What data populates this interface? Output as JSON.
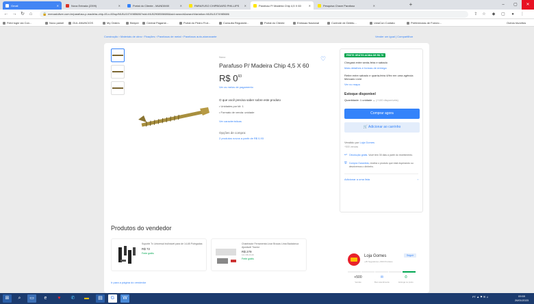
{
  "browser": {
    "tabs": [
      {
        "label": "Gmail"
      },
      {
        "label": "Nova Entrada (2399)"
      },
      {
        "label": "Portal do Cliente - MUNDIMIX"
      },
      {
        "label": "PARAFUSO CHIPBOARD PHILLIPS"
      },
      {
        "label": "Parafuso P/ Madeira Chip 4,5 X 60"
      },
      {
        "label": "Pesquisa Chave Parafuso"
      }
    ],
    "url": "mercadolivre.com.br/parafuso-p-madeira-chip-45-x-60/up/MLBU1074985686?wid=MLB2908506686&sid=search&searchVariation=MLBU1074985686",
    "bookmarks": [
      "Field login via Con...",
      "Novo painel",
      "GUL ANUNCIOS",
      "My Orders",
      "Beeper",
      "Central Pagame...",
      "Portal do Pedro Frut...",
      "Consulta Regularid...",
      "Portal do Cliente",
      "Emissao Nacional",
      "Controle de Debito...",
      "UniaCon Contato",
      "Preferencias de Fornec...",
      "Outros favoritos"
    ]
  },
  "page": {
    "breadcrumb": "Construção › Materiais de obra › Fixações › Parafusos de metal › Parafusos auto-atarraxante",
    "top_links": "Vender um igual | Compartilhar",
    "product": {
      "condition": "Novo",
      "title": "Parafuso P/ Madeira Chip 4,5 X 60",
      "price_int": "R$ 0",
      "price_cents": "93",
      "payment_link": "Ver os meios de pagamento",
      "about_title": "O que você precisa saber sobre este produto",
      "bullets": [
        "Unidades por kit: 1",
        "Formato de venda: unidade"
      ],
      "features_link": "Ver características",
      "purchase_options_title": "Opções de compra:",
      "purchase_options_link": "2 produtos novos a partir de R$ 0,93"
    },
    "side": {
      "badge": "FRETE GRÁTIS ACIMA DE R$ 79",
      "delivery_text": "Chegará entre sexta-feira e sábado",
      "delivery_link": "Mais detalhes e formas de entrega",
      "pickup_text": "Retire entre sábado e quarta-feira 4/fev em uma agência Mercado Livre",
      "pickup_link": "Ver no mapa",
      "stock": "Estoque disponível",
      "qty_label": "Quantidade: 1 unidade",
      "qty_available": "(+100 disponíveis)",
      "buy_label": "Comprar agora",
      "cart_label": "Adicionar ao carrinho",
      "seller_prefix": "Vendido por",
      "seller_name": "Loja Gomes",
      "seller_sales": "+500 vendas",
      "benefit1_link": "Devolução grátis.",
      "benefit1_text": "Você tem 30 dias a partir do recebimento.",
      "benefit2_link": "Compra Garantida,",
      "benefit2_text": "receba o produto que está esperando ou devolvemos o dinheiro.",
      "more_options": "Adicionar a uma lista"
    },
    "vendor": {
      "section_title": "Produtos do vendedor",
      "items": [
        {
          "name": "Suporte Tv Universal Inclinável para de 14-65 Polegadas",
          "price": "R$ 72",
          "sub": "",
          "free": "Frete grátis"
        },
        {
          "name": "Chanfrador Ferramenta Lixar Brocas Lima Badalonca Ajustável Tractor",
          "price": "R$ 279",
          "sub": "12x R$ 23,26",
          "free": "Frete grátis"
        }
      ],
      "link": "Ir para a página do vendedor"
    },
    "store": {
      "name": "Loja Gomes",
      "meta": "+25 Seguidores +500 Produtos",
      "follow": "Seguir",
      "stats": [
        {
          "v": "+500",
          "l": "Vendas"
        },
        {
          "v": "✉",
          "l": "Bom atendimento"
        },
        {
          "v": "⏱",
          "l": "Entrega no prazo"
        }
      ]
    }
  },
  "taskbar": {
    "tray": "PT  ▲  ⚑  ✉  ♫",
    "time": "09:59",
    "date": "26/01/2023"
  },
  "colors": {
    "accent": "#3483fa",
    "green": "#00a650",
    "taskbar": "#1c3b6e"
  }
}
